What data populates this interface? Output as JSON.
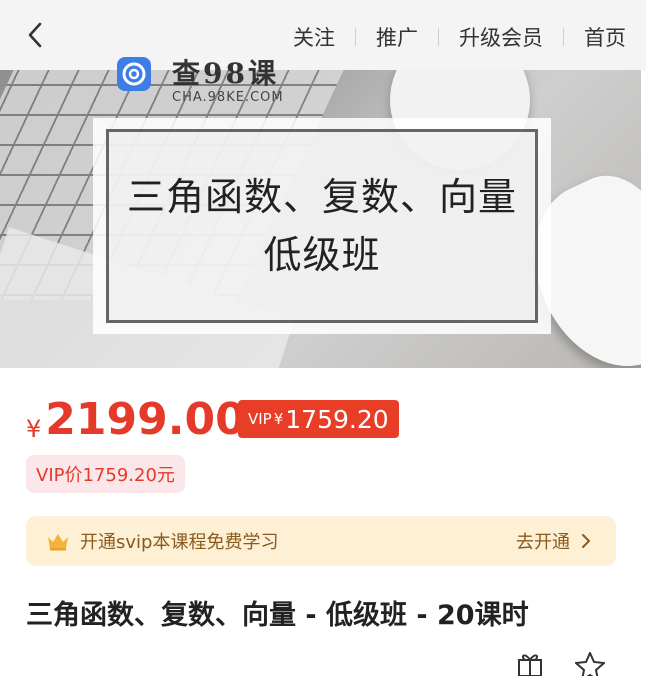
{
  "nav": {
    "items": [
      {
        "label": "关注"
      },
      {
        "label": "推广"
      },
      {
        "label": "升级会员"
      },
      {
        "label": "首页"
      }
    ]
  },
  "banner": {
    "logo_text": "查98课",
    "logo_sub": "CHA.98KE.COM",
    "line1": "三角函数、复数、向量",
    "line2": "低级班"
  },
  "price": {
    "currency": "¥",
    "value": "2199.00",
    "vip_tag_label": "VIP",
    "vip_tag_currency": "¥",
    "vip_tag_value": "1759.20",
    "vip_price_text": "VIP价1759.20元"
  },
  "svip": {
    "text": "开通svip本课程免费学习",
    "cta": "去开通"
  },
  "course": {
    "title": "三角函数、复数、向量 - 低级班 - 20课时"
  },
  "colors": {
    "accent": "#e53a2a",
    "svip_bg": "#fdf0d4",
    "svip_text": "#8a5a1e"
  },
  "icons": [
    "back-arrow-icon",
    "crown-icon",
    "chevron-right-icon",
    "gift-icon",
    "star-icon"
  ]
}
